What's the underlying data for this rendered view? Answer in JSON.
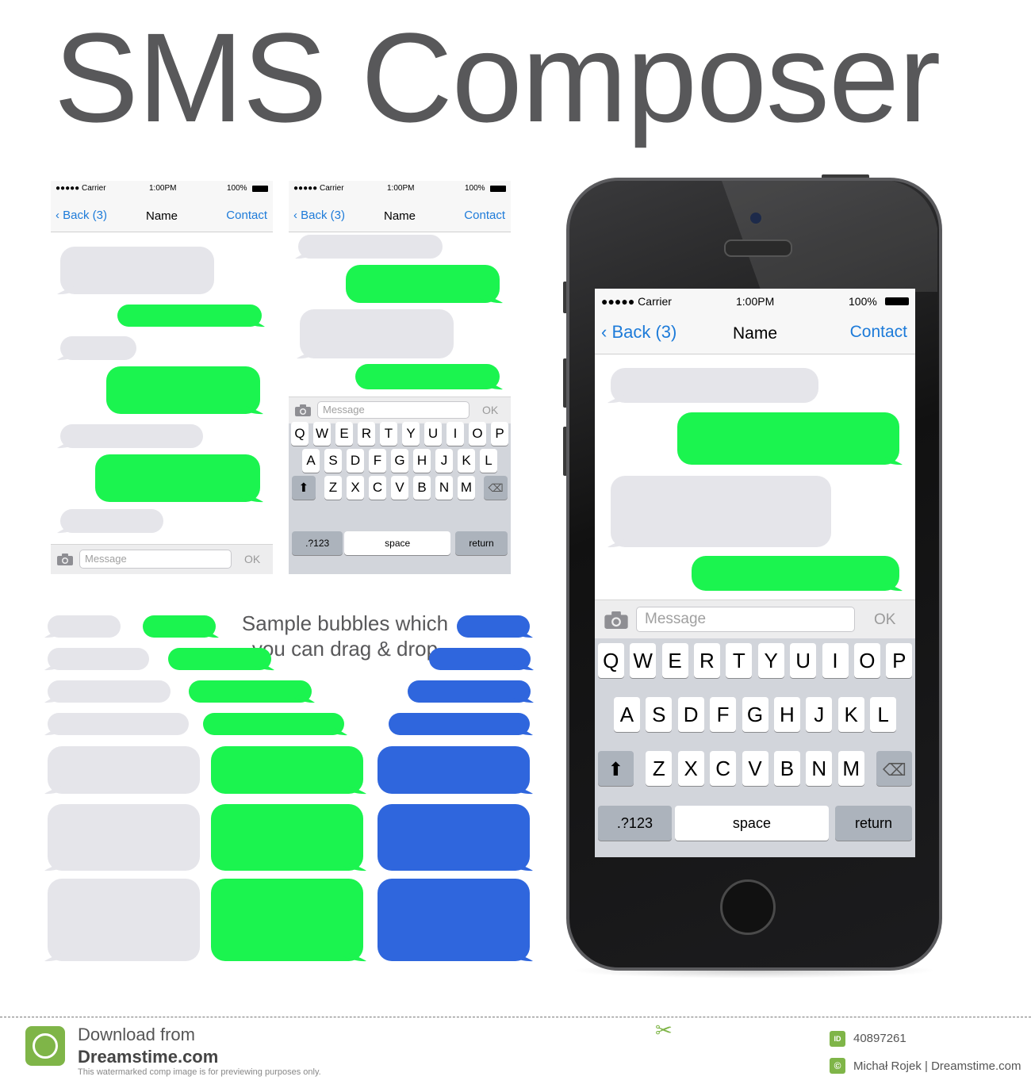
{
  "title": "SMS Composer",
  "colors": {
    "green": "#1bf44f",
    "gray": "#e5e5ea",
    "blue": "#2f66dd",
    "link": "#1d7bd9"
  },
  "status": {
    "carrier": "●●●●● Carrier",
    "time": "1:00PM",
    "battery": "100%"
  },
  "nav": {
    "back": "Back (3)",
    "name": "Name",
    "contact": "Contact"
  },
  "input": {
    "placeholder": "Message",
    "ok": "OK"
  },
  "keyboard": {
    "row1": [
      "Q",
      "W",
      "E",
      "R",
      "T",
      "Y",
      "U",
      "I",
      "O",
      "P"
    ],
    "row2": [
      "A",
      "S",
      "D",
      "F",
      "G",
      "H",
      "J",
      "K",
      "L"
    ],
    "row3": [
      "Z",
      "X",
      "C",
      "V",
      "B",
      "N",
      "M"
    ],
    "numbers": ".?123",
    "space": "space",
    "return": "return"
  },
  "caption": "Sample bubbles which you can drag & drop",
  "footer": {
    "download": "Download from",
    "site": "Dreamstime.com",
    "note": "This watermarked comp image is for previewing purposes only.",
    "id": "40897261",
    "author": "Michał Rojek | Dreamstime.com",
    "id_badge": "ID",
    "c_badge": "©"
  }
}
